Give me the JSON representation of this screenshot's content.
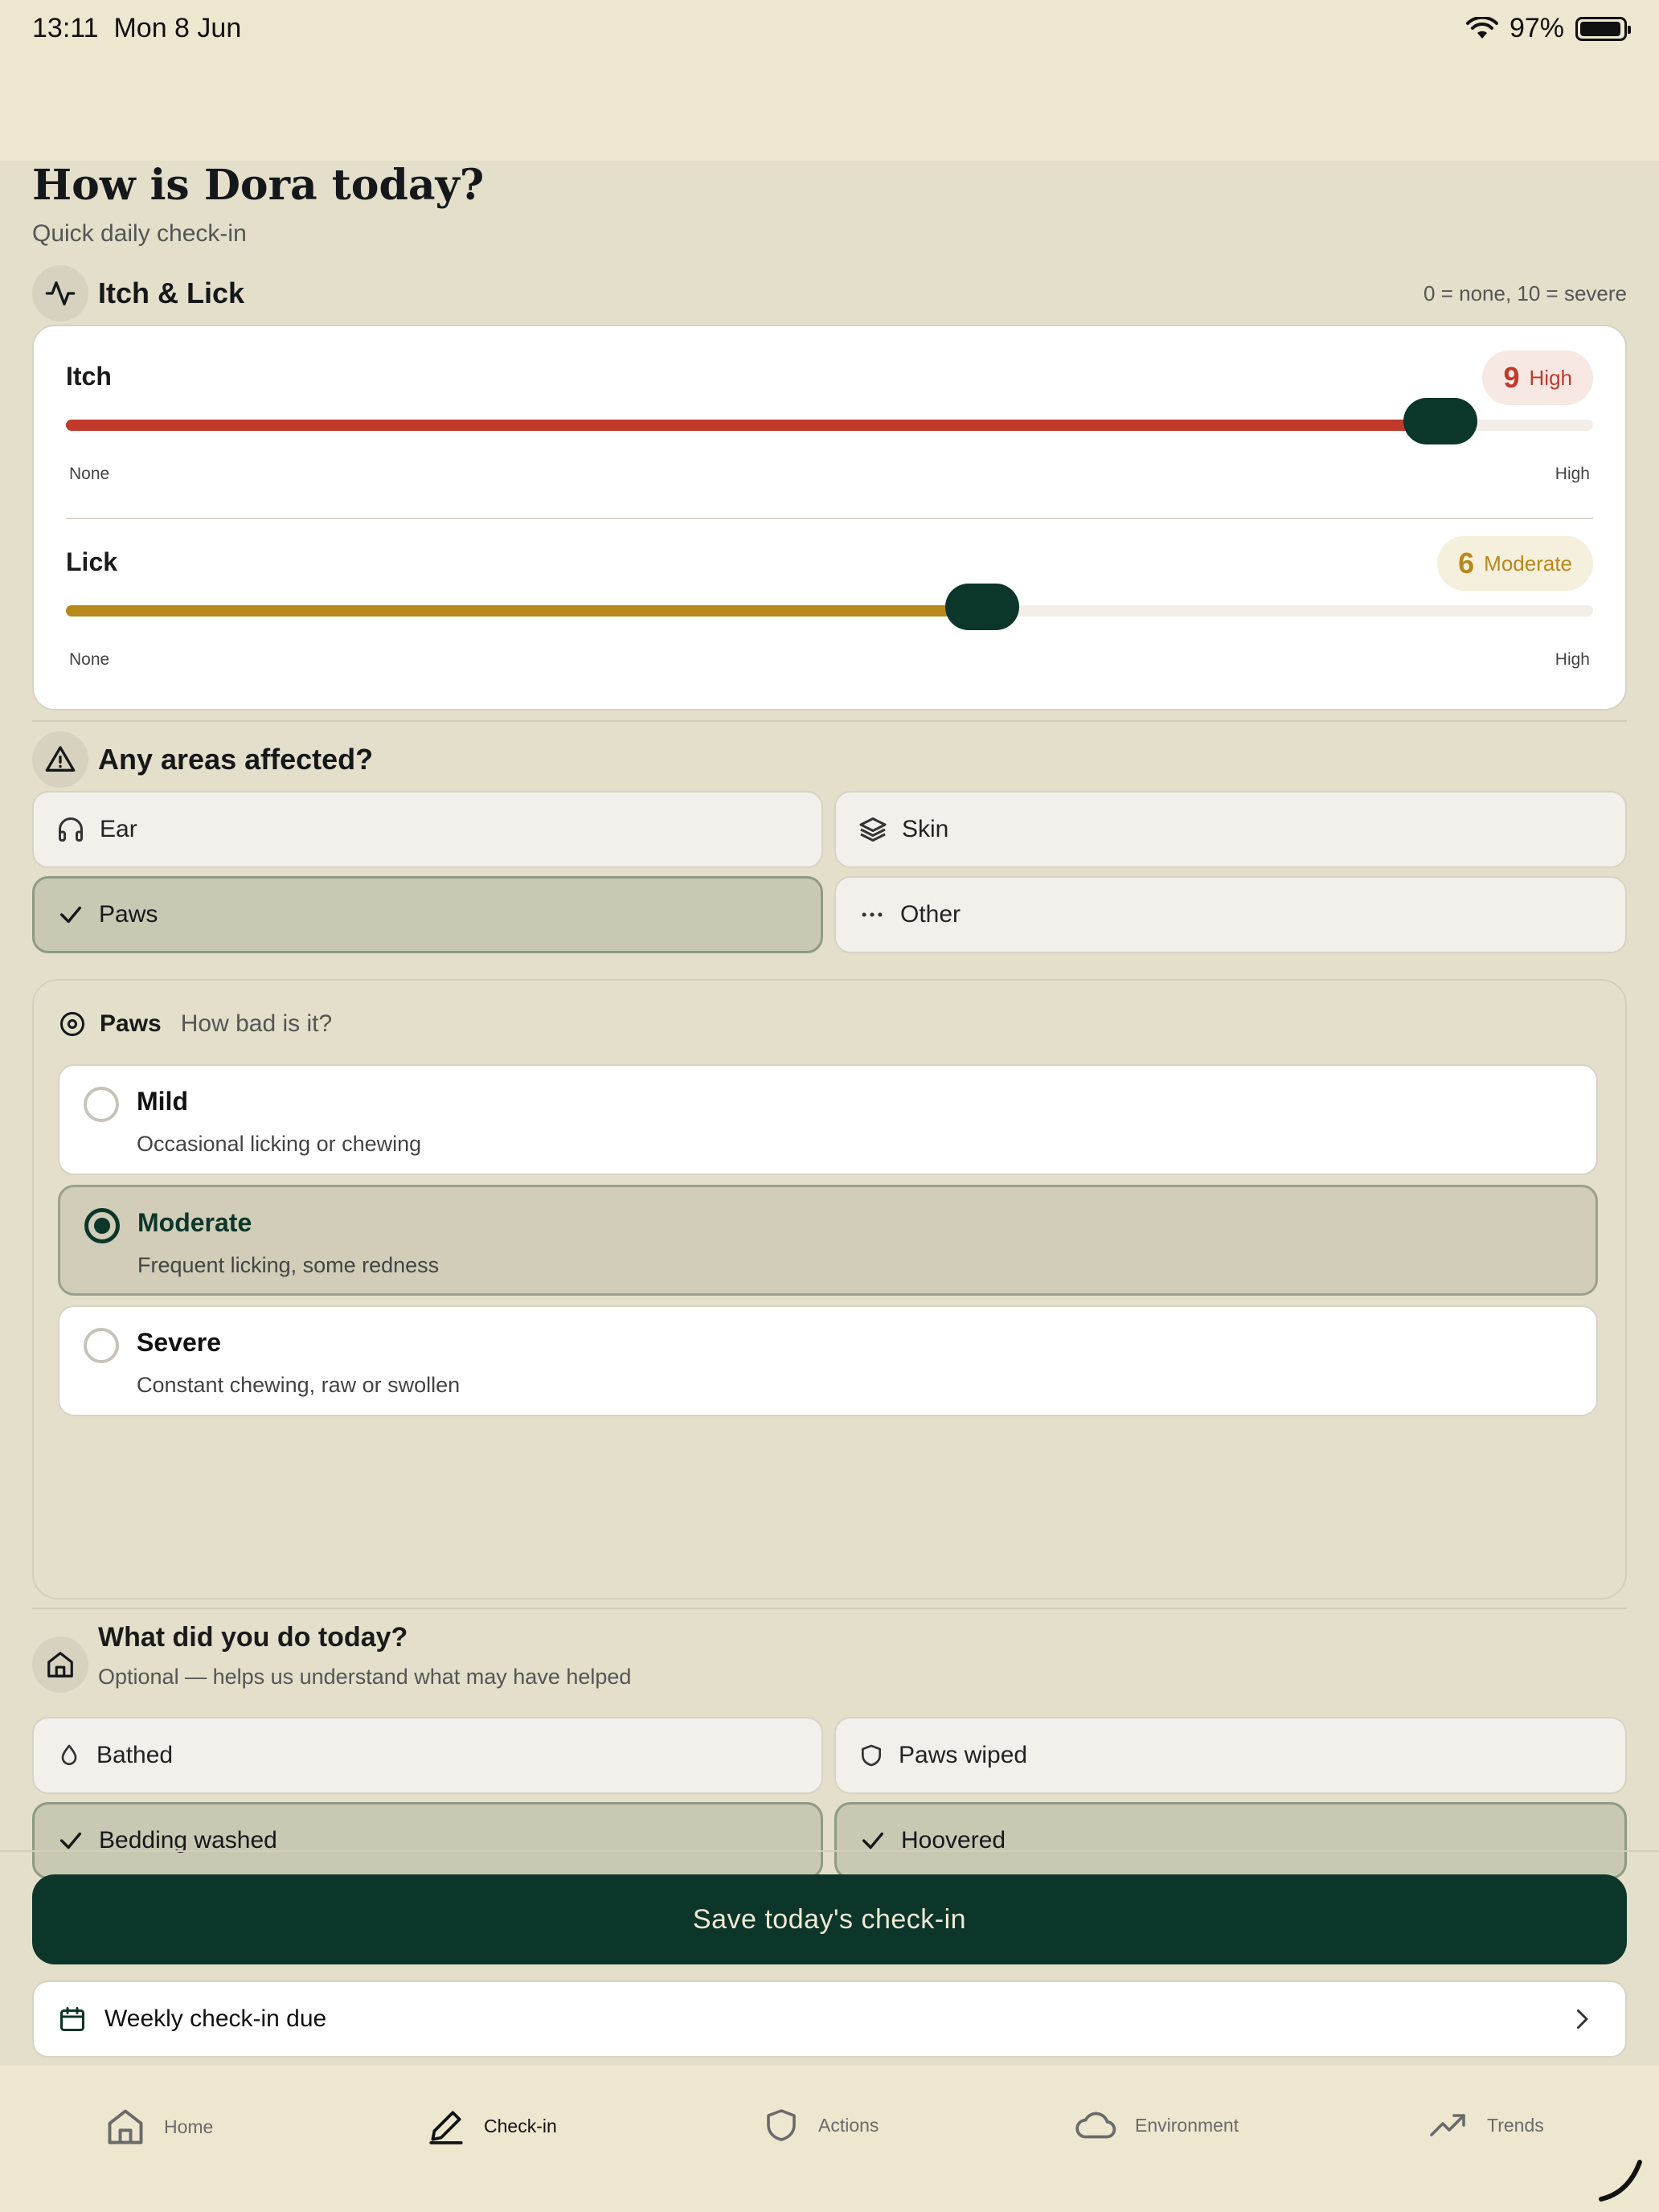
{
  "status": {
    "time": "13:11",
    "date": "Mon 8 Jun",
    "battery": "97%",
    "battery_level": 0.97
  },
  "header": {
    "title": "How is Dora today?",
    "subtitle": "Quick daily check-in"
  },
  "itch_lick": {
    "title": "Itch & Lick",
    "hint": "0 = none, 10 = severe",
    "sliders": [
      {
        "label": "Itch",
        "value": 9,
        "level": "High",
        "min": 0,
        "max": 10,
        "low_label": "None",
        "high_label": "High",
        "color": "#c0392b",
        "badge_bg": "#f7e8e4"
      },
      {
        "label": "Lick",
        "value": 6,
        "level": "Moderate",
        "min": 0,
        "max": 10,
        "low_label": "None",
        "high_label": "High",
        "color": "#b8891a",
        "badge_bg": "#f5efdd"
      }
    ]
  },
  "areas": {
    "title": "Any areas affected?",
    "items": [
      {
        "label": "Ear",
        "icon": "headphones-icon",
        "selected": false
      },
      {
        "label": "Skin",
        "icon": "layers-icon",
        "selected": false
      },
      {
        "label": "Paws",
        "icon": "check-icon",
        "selected": true
      },
      {
        "label": "Other",
        "icon": "more-horizontal-icon",
        "selected": false
      }
    ]
  },
  "severity": {
    "area": "Paws",
    "question": "How bad is it?",
    "options": [
      {
        "title": "Mild",
        "desc": "Occasional licking or chewing",
        "selected": false
      },
      {
        "title": "Moderate",
        "desc": "Frequent licking, some redness",
        "selected": true
      },
      {
        "title": "Severe",
        "desc": "Constant chewing, raw or swollen",
        "selected": false
      }
    ]
  },
  "actions": {
    "title": "What did you do today?",
    "subtitle": "Optional — helps us understand what may have helped",
    "items": [
      {
        "label": "Bathed",
        "icon": "droplet-icon",
        "selected": false
      },
      {
        "label": "Paws wiped",
        "icon": "shield-icon",
        "selected": false
      },
      {
        "label": "Bedding washed",
        "icon": "check-icon",
        "selected": true
      },
      {
        "label": "Hoovered",
        "icon": "check-icon",
        "selected": true
      }
    ]
  },
  "save_label": "Save today's check-in",
  "weekly_label": "Weekly check-in due",
  "tabs": [
    {
      "label": "Home",
      "icon": "home-icon",
      "active": false
    },
    {
      "label": "Check-in",
      "icon": "pencil-icon",
      "active": true
    },
    {
      "label": "Actions",
      "icon": "shield-icon",
      "active": false
    },
    {
      "label": "Environment",
      "icon": "cloud-icon",
      "active": false
    },
    {
      "label": "Trends",
      "icon": "trending-up-icon",
      "active": false
    }
  ],
  "colors": {
    "primary": "#0b3629",
    "background": "#e4dfca",
    "chip_selected": "#c9c8b2"
  }
}
